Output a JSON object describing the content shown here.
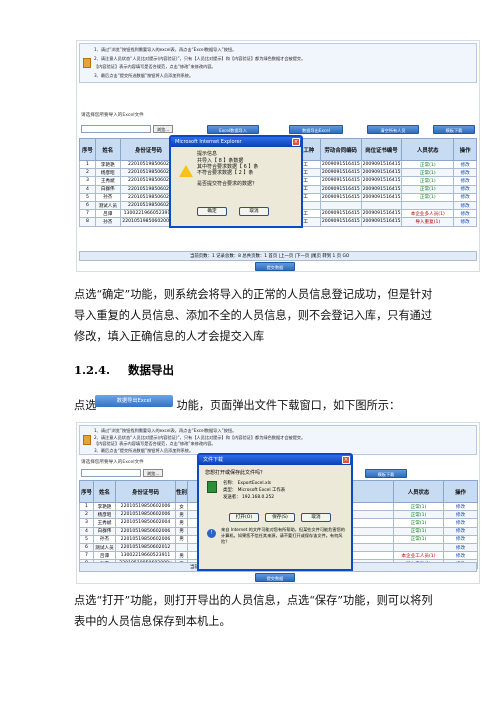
{
  "shot1": {
    "tips": [
      "1、请过“浏览”按钮找到需要导入的excel表，再点击“Excel数据导入”按钮。",
      "2、请注意人员状态“人员比对提示(内容验证)”，只有【人员比对提示】和【内容验证】都为绿色数据才会被提交。",
      "【内容验证】表示内容填写是否合规范，点击“修改”来修改内容。",
      "3、最后点击“提交所选数据”按钮将人员添加到系统。"
    ],
    "section_label": "请选择您所要导入的Excel文件",
    "browse_label": "浏览...",
    "buttons": [
      "Excel数据导入",
      "数据导出Excel",
      "清空所有人员",
      "模板下载"
    ],
    "columns": [
      "序号",
      "姓名",
      "身份证号码",
      "性别",
      "出生年月",
      "住址",
      "岗位工种",
      "劳动合同编码",
      "岗位证书编号",
      "人员状态",
      "操作"
    ],
    "rows": [
      [
        "1",
        "李艳艳",
        "22010519850602",
        "",
        "",
        "",
        "管工",
        "2009091516415",
        "2009091516415",
        "正常(1)",
        "修改"
      ],
      [
        "2",
        "杨彦昭",
        "22010519850602",
        "",
        "",
        "",
        "管工",
        "2009091516415",
        "2009091516415",
        "正常(1)",
        "修改"
      ],
      [
        "3",
        "王秀斌",
        "22010519850602",
        "",
        "",
        "",
        "管工",
        "2009091516415",
        "2009091516415",
        "正常(1)",
        "修改"
      ],
      [
        "4",
        "白群伟",
        "22010519850602",
        "",
        "",
        "",
        "管工",
        "2009091516415",
        "2009091516415",
        "正常(1)",
        "修改"
      ],
      [
        "5",
        "孙杰",
        "22010519850602",
        "",
        "",
        "",
        "管工",
        "2009091516415",
        "2009091516415",
        "正常(1)",
        "修改"
      ],
      [
        "6",
        "测试人员",
        "22010519850602",
        "",
        "",
        "",
        "",
        "",
        "",
        "",
        "修改"
      ],
      [
        "7",
        "吕谭",
        "13002219660523911",
        "男",
        "1996-06-23",
        "辽宁省大连市项目作业人员",
        "管工",
        "2009091516415",
        "2009091516415",
        "本企业多人员(1)",
        "修改"
      ],
      [
        "8",
        "孙杰",
        "22010519850602008x",
        "男",
        "1984-08-20",
        "辽宁省大连市项目作业人员",
        "管工",
        "2009091516415",
        "2009091516415",
        "导入重复(1)",
        "修改"
      ]
    ],
    "pager": "当前页数：1   记录总数：8   总共页数：1   首页 |上一页 |下一页 |尾页   转到 1 页 GO",
    "submit_label": "提交数据",
    "dialog": {
      "title": "Microsoft Internet Explorer",
      "lines": [
        "提示信息",
        "共导入【 8 】条数据",
        "其中符合要求数据【 6 】条",
        "不符合要求数据【 2 】条",
        "是否提交符合要求的数据？"
      ],
      "ok": "确定",
      "cancel": "取消"
    }
  },
  "para1": "点选“确定”功能，则系统会将导入的正常的人员信息登记成功，但是针对导入重复的人员信息、添加不全的人员信息，则不会登记入库，只有通过修改，填入正确信息的人才会提交入库",
  "heading": {
    "num": "1.2.4.",
    "title": "数据导出"
  },
  "para2": {
    "before": "点选",
    "button_label": "数据导出Excel",
    "after": "功能，页面弹出文件下载窗口，如下图所示："
  },
  "shot2": {
    "section_label": "请选择您所要导入的Excel文件",
    "browse_label": "浏览...",
    "buttons": [
      "模板下载"
    ],
    "columns": [
      "序号",
      "姓名",
      "身份证号码",
      "性别",
      "岗位证书编号",
      "人员状态",
      "操作"
    ],
    "rows": [
      [
        "1",
        "李艳艳",
        "22010519850602006",
        "女",
        "2009091516415",
        "正常(1)",
        "修改"
      ],
      [
        "2",
        "杨彦昭",
        "22010519850602006",
        "男",
        "2009091516415",
        "正常(1)",
        "修改"
      ],
      [
        "3",
        "王秀斌",
        "22010519850602004",
        "男",
        "2009091516415",
        "正常(1)",
        "修改"
      ],
      [
        "4",
        "白群伟",
        "22010519850602006",
        "男",
        "2009091516415",
        "正常(1)",
        "修改"
      ],
      [
        "5",
        "孙杰",
        "22010519850602006",
        "男",
        "2009091516415",
        "正常(1)",
        "修改"
      ],
      [
        "6",
        "测试人员",
        "22010519850602012",
        "",
        "",
        "",
        "修改"
      ],
      [
        "7",
        "吕谭",
        "13002219660523911",
        "男",
        "2009091516415",
        "本企业工人员(1)",
        "修改"
      ],
      [
        "8",
        "孙杰",
        "22010519850602008x",
        "男",
        "2009091516415",
        "导入重复(1)",
        "修改"
      ]
    ],
    "pager": "当前页数：1   记录总数：8   总共页数：1   首页 |上一页 |下一页 |尾页   转到 1 页",
    "submit_label": "提交数据",
    "dialog": {
      "title": "文件下载",
      "question": "您想打开或保存此文件吗？",
      "name_label": "名称：",
      "name": "ExportExcel.xls",
      "type_label": "类型：",
      "type": "Microsoft Excel 工作表",
      "from_label": "发送者：",
      "from": "192.168.0.252",
      "open": "打开(O)",
      "save": "保存(S)",
      "cancel": "取消",
      "note": "来自 Internet 的文件可能对您有所帮助，但某些文件可能危害您的计算机。如果您不信任其来源，请不要打开或保存该文件。有何风险？"
    }
  },
  "para3": "点选“打开”功能，则打开导出的人员信息，点选“保存”功能，则可以将列表中的人员信息保存到本机上。"
}
